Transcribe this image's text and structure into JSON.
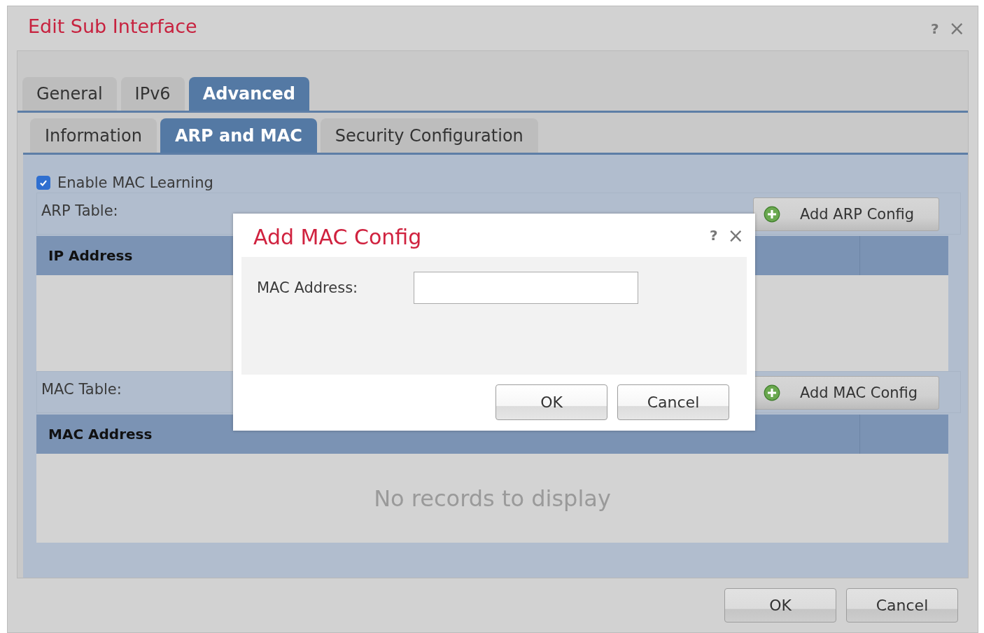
{
  "dialog": {
    "title": "Edit Sub Interface",
    "help": "?",
    "close": "×"
  },
  "tabs": [
    {
      "label": "General",
      "selected": false
    },
    {
      "label": "IPv6",
      "selected": false
    },
    {
      "label": "Advanced",
      "selected": true
    }
  ],
  "subtabs": [
    {
      "label": "Information",
      "selected": false
    },
    {
      "label": "ARP and MAC",
      "selected": true
    },
    {
      "label": "Security Configuration",
      "selected": false
    }
  ],
  "mac_learning": {
    "label": "Enable MAC Learning",
    "checked": true
  },
  "tables": [
    {
      "label": "ARP Table:",
      "button": "Add ARP Config",
      "columns": [
        "IP Address"
      ]
    },
    {
      "label": "MAC Table:",
      "button": "Add MAC Config",
      "columns": [
        "MAC Address"
      ],
      "empty_text": "No records to display"
    }
  ],
  "buttons": [
    "OK",
    "Cancel"
  ],
  "modal": {
    "title": "Add MAC Config",
    "help": "?",
    "close": "×",
    "field": {
      "label": "MAC Address:"
    },
    "buttons": [
      "OK",
      "Cancel"
    ]
  }
}
